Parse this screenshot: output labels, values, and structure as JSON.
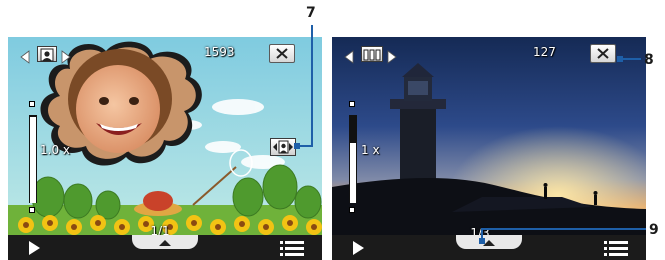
{
  "left_screen": {
    "counter": "1593",
    "zoom_label": "1.0 x",
    "page_indicator": "1/1",
    "icons": {
      "prev": "triangle-left-icon",
      "mode": "portrait-mode-icon",
      "next": "triangle-right-icon",
      "close": "close-x-icon",
      "template_toggle": "portrait-template-icon",
      "play": "play-icon",
      "up": "up-arrow-icon",
      "menu": "menu-list-icon"
    }
  },
  "right_screen": {
    "counter": "127",
    "zoom_label": "1 x",
    "page_indicator": "1/3",
    "icons": {
      "prev": "triangle-left-icon",
      "mode": "burst-mode-icon",
      "next": "triangle-right-icon",
      "close": "close-x-icon",
      "play": "play-icon",
      "up": "up-arrow-icon",
      "menu": "menu-list-icon"
    }
  },
  "callouts": {
    "seven": "7",
    "eight": "8",
    "nine": "9"
  },
  "colors": {
    "callout": "#1e5fa8",
    "toolbar": "#1b1b1b"
  }
}
